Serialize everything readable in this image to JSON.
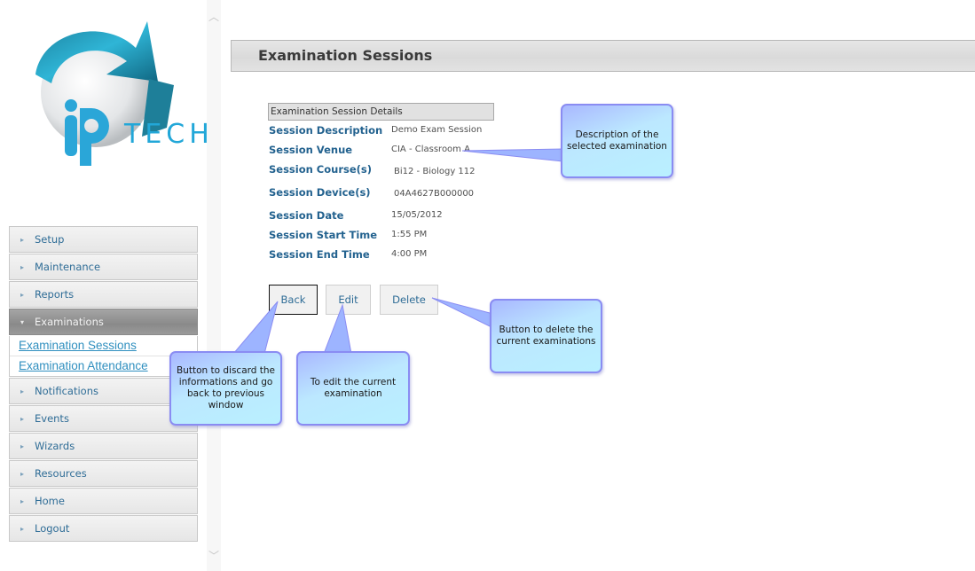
{
  "logo": {
    "alt": "IP TECH logo",
    "wordmark": "TECH"
  },
  "sidebar": {
    "items": [
      {
        "label": "Setup",
        "expanded": false
      },
      {
        "label": "Maintenance",
        "expanded": false
      },
      {
        "label": "Reports",
        "expanded": false
      },
      {
        "label": "Examinations",
        "expanded": true,
        "children": [
          {
            "label": "Examination Sessions"
          },
          {
            "label": "Examination Attendance"
          }
        ]
      },
      {
        "label": "Notifications",
        "expanded": false
      },
      {
        "label": "Events",
        "expanded": false
      },
      {
        "label": "Wizards",
        "expanded": false
      },
      {
        "label": "Resources",
        "expanded": false
      },
      {
        "label": "Home",
        "expanded": false
      },
      {
        "label": "Logout",
        "expanded": false
      }
    ],
    "icons": {
      "collapsed": "▸",
      "expanded": "▾"
    }
  },
  "scrollbar": {
    "up_icon": "︿",
    "down_icon": "﹀"
  },
  "header": {
    "title": "Examination Sessions"
  },
  "details": {
    "section_title": "Examination Session Details",
    "fields": [
      {
        "label": "Session Description",
        "value": "Demo Exam Session"
      },
      {
        "label": "Session Venue",
        "value": "CIA - Classroom A"
      },
      {
        "label": "Session Course(s)",
        "value": "Bi12 - Biology 112"
      },
      {
        "label": "Session Device(s)",
        "value": "04A4627B000000"
      },
      {
        "label": "Session Date",
        "value": "15/05/2012"
      },
      {
        "label": "Session Start Time",
        "value": "1:55 PM"
      },
      {
        "label": "Session End Time",
        "value": "4:00 PM"
      }
    ]
  },
  "buttons": {
    "back": "Back",
    "edit": "Edit",
    "delete": "Delete"
  },
  "callouts": {
    "description": "Description of the selected examination",
    "delete": "Button to delete the current examinations",
    "back": "Button to discard the informations and go back to previous window",
    "edit": "To edit the current examination"
  },
  "colors": {
    "link": "#2f8fbf",
    "label": "#23628f",
    "callout_border": "#8a8cf2",
    "callout_fill": "#b9f0ff"
  }
}
